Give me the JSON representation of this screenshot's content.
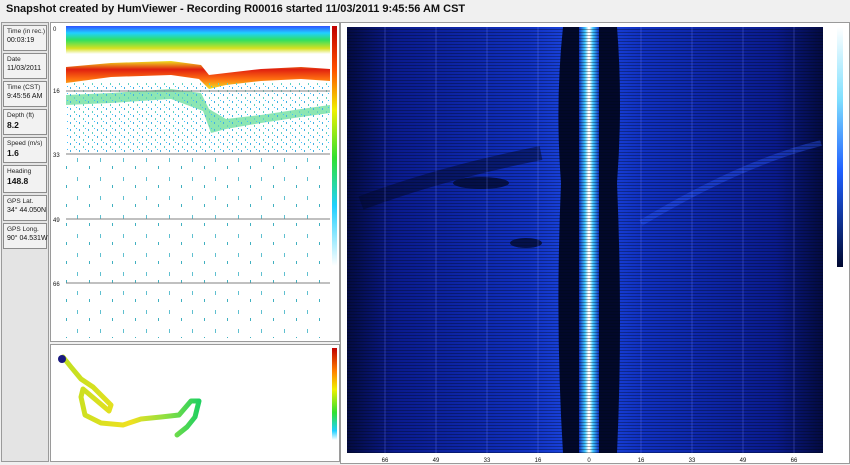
{
  "window": {
    "title": "Snapshot created by HumViewer - Recording R00016 started 11/03/2011 9:45:56 AM CST"
  },
  "info_fields": [
    {
      "label": "Time (in rec.)",
      "value": "00:03:19"
    },
    {
      "label": "Date",
      "value": "11/03/2011"
    },
    {
      "label": "Time (CST)",
      "value": "9:45:56 AM"
    },
    {
      "label": "Depth (ft)",
      "value": "8.2"
    },
    {
      "label": "Speed (m/s)",
      "value": "1.6"
    },
    {
      "label": "Heading",
      "value": "148.8"
    },
    {
      "label": "GPS Lat.",
      "value": "34° 44.050N"
    },
    {
      "label": "GPS Long.",
      "value": "90° 04.531W"
    }
  ],
  "sonar": {
    "depth_ticks": [
      "0",
      "16",
      "33",
      "49",
      "66"
    ]
  },
  "side_imaging": {
    "range_ticks": [
      "66",
      "49",
      "33",
      "16",
      "0",
      "16",
      "33",
      "49",
      "66"
    ]
  },
  "colors": {
    "background": "#f0f0f0",
    "side_image_deep": "#0a1a8c",
    "side_image_bright": "#40c8ff",
    "sonar_bottom": "#d01010",
    "track_start": "#2060ff",
    "track_end": "#20d060"
  }
}
